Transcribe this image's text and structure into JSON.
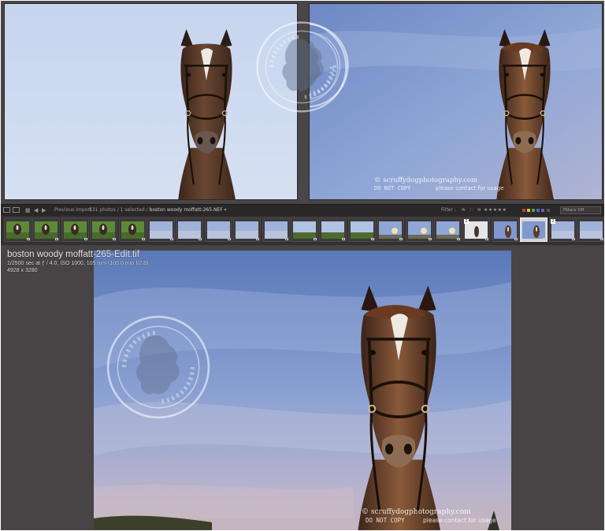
{
  "toolbar": {
    "previous_import": "Previous Import",
    "counts": "531 photos / 1 selected /",
    "selected_file": "boston woody moffatt-265.NEF",
    "dropdown_glyph": "▾",
    "filter_label": "Filter :",
    "stars": "★★★★★",
    "filters_off": "Filters Off"
  },
  "filmstrip": {
    "selected_index": 18,
    "thumb_types": [
      "grass-horse",
      "grass-horse",
      "grass-horse",
      "grass-horse",
      "grass-horse",
      "sky",
      "sky",
      "sky",
      "sky",
      "sky",
      "field",
      "field",
      "field",
      "sky-sun",
      "sky-sun",
      "sky-sun",
      "white-horse",
      "blue-horse",
      "blue-horse",
      "sky",
      "sky"
    ],
    "number_badge": "2"
  },
  "photo": {
    "filename": "boston woody moffatt-265-Edit.tif",
    "exposure": "1/2500 sec at ƒ / 4.0, ISO 1000, 105 mm (105.0 mm f/2.8)",
    "dimensions": "4928 x 3280"
  },
  "watermark": {
    "site": "© scruffydogphotography.com",
    "notice_left": "DO NOT COPY",
    "notice_right": "please contact for usage"
  },
  "colors": {
    "sky_light": "#c8d6ee",
    "sky_blue": "#7d97cc",
    "horse_brown": "#4e3427",
    "app_bg": "#464143"
  }
}
